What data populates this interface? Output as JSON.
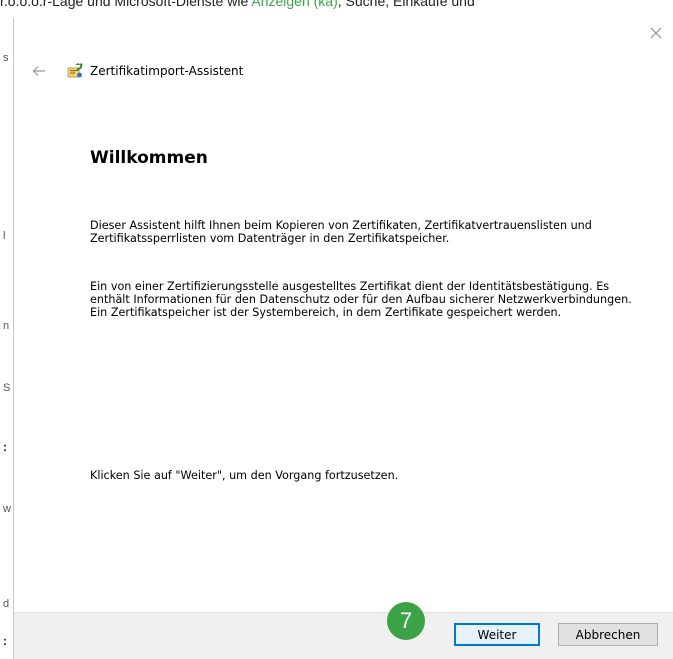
{
  "background": {
    "top_text_prefix": "r.o.o.o.r-Lage und Microsoft-Dienste wie",
    "top_text_highlight": "Anzeigen (ka)",
    "top_text_suffix": ", Suche, Einkäufe und",
    "left_fragments": [
      "s",
      "l",
      "n",
      "S",
      ":",
      "w",
      "d",
      ":"
    ]
  },
  "dialog": {
    "title": "Zertifikatimport-Assistent",
    "heading": "Willkommen",
    "para1": "Dieser Assistent hilft Ihnen beim Kopieren von Zertifikaten, Zertifikatvertrauenslisten und Zertifikatssperrlisten vom Datenträger in den Zertifikatspeicher.",
    "para2": "Ein von einer Zertifizierungsstelle ausgestelltes Zertifikat dient der Identitätsbestätigung. Es enthält Informationen für den Datenschutz oder für den Aufbau sicherer Netzwerkverbindungen. Ein Zertifikatspeicher ist der Systembereich, in dem Zertifikate gespeichert werden.",
    "para3": "Klicken Sie auf \"Weiter\", um den Vorgang fortzusetzen.",
    "next_label": "Weiter",
    "cancel_label": "Abbrechen"
  },
  "annotation": {
    "step_number": "7",
    "color": "#3ba245"
  },
  "colors": {
    "accent": "#0078d7",
    "footer_bg": "#f0f0f0"
  }
}
